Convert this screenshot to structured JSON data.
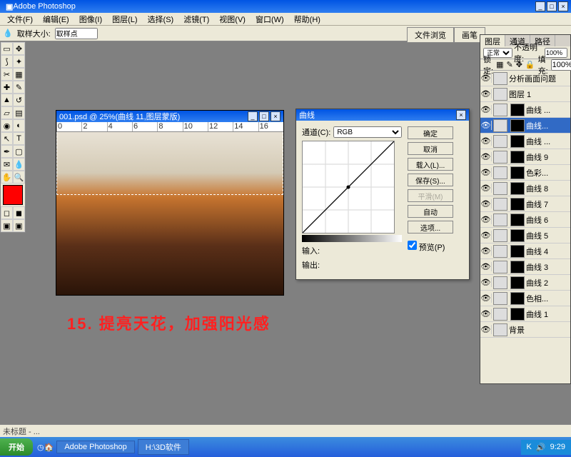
{
  "app": {
    "title": "Adobe Photoshop"
  },
  "menu": {
    "file": "文件(F)",
    "edit": "编辑(E)",
    "image": "图像(I)",
    "layer": "图层(L)",
    "select": "选择(S)",
    "filter": "滤镜(T)",
    "view": "视图(V)",
    "window": "窗口(W)",
    "help": "帮助(H)"
  },
  "optbar": {
    "label": "取样大小:",
    "value": "取样点"
  },
  "apptabs": {
    "a": "文件浏览",
    "b": "画笔"
  },
  "doc": {
    "title": "001.psd @ 25%(曲线 11,图层蒙版)",
    "ruler": [
      "0",
      "2",
      "4",
      "6",
      "8",
      "10",
      "12",
      "14",
      "16"
    ]
  },
  "annotation": {
    "text": "15. 提亮天花，加强阳光感"
  },
  "curves": {
    "title": "曲线",
    "channel_label": "通道(C):",
    "channel": "RGB",
    "btn_ok": "确定",
    "btn_cancel": "取消",
    "btn_load": "载入(L)...",
    "btn_save": "保存(S)...",
    "btn_smooth": "平滑(M)",
    "btn_auto": "自动",
    "btn_options": "选项...",
    "input": "输入:",
    "output": "输出:",
    "preview": "预览(P)"
  },
  "layers_panel": {
    "tabs": {
      "layers": "图层",
      "channels": "通道",
      "paths": "路径"
    },
    "mode": "正常",
    "opacity_label": "不透明度:",
    "opacity": "100%",
    "lock": "锁定:",
    "fill_label": "填充:",
    "fill": "100%",
    "items": [
      {
        "name": "分析画面问题"
      },
      {
        "name": "图层 1"
      },
      {
        "name": "曲线 ..."
      },
      {
        "name": "曲线..."
      },
      {
        "name": "曲线 ..."
      },
      {
        "name": "曲线 9"
      },
      {
        "name": "色彩..."
      },
      {
        "name": "曲线 8"
      },
      {
        "name": "曲线 7"
      },
      {
        "name": "曲线 6"
      },
      {
        "name": "曲线 5"
      },
      {
        "name": "曲线 4"
      },
      {
        "name": "曲线 3"
      },
      {
        "name": "曲线 2"
      },
      {
        "name": "色相..."
      },
      {
        "name": "曲线 1"
      },
      {
        "name": "背景"
      }
    ]
  },
  "infobar": {
    "a": "未标题 - ..."
  },
  "taskbar": {
    "start": "开始",
    "task1": "Adobe Photoshop",
    "task2": "H:\\3D软件",
    "time": "9:29"
  }
}
